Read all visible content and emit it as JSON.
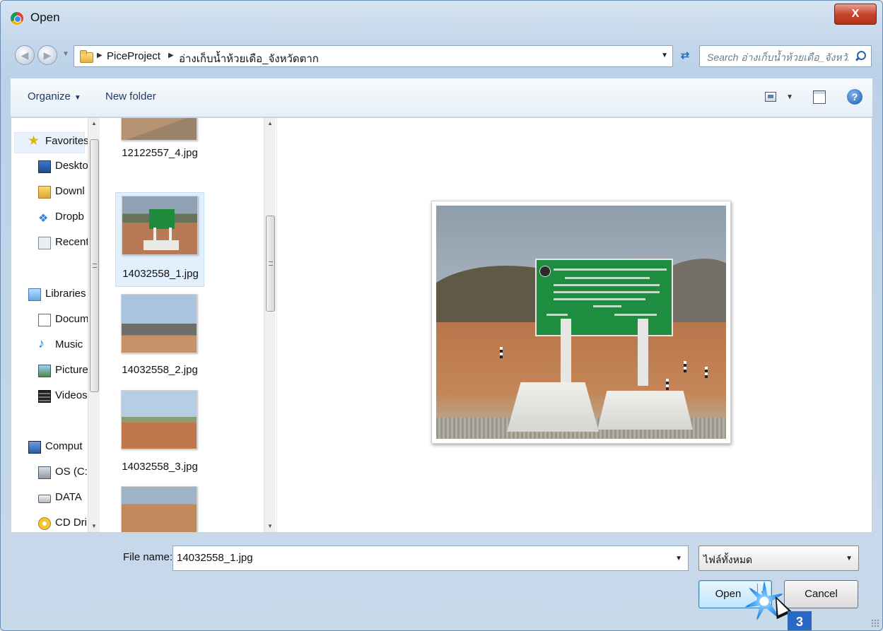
{
  "window": {
    "title": "Open",
    "close_label": "X"
  },
  "address": {
    "crumbs": [
      "PiceProject",
      "อ่างเก็บน้ำห้วยเดือ_จังหวัดตาก"
    ],
    "search_placeholder": "Search อ่างเก็บน้ำห้วยเดือ_จังหวั..."
  },
  "toolbar": {
    "organize_label": "Organize",
    "new_folder_label": "New folder",
    "help_label": "?"
  },
  "nav": {
    "items": [
      {
        "label": "Favorites",
        "icon": "star-icon"
      },
      {
        "label": "Deskto",
        "icon": "desktop-icon"
      },
      {
        "label": "Downl",
        "icon": "downloads-icon"
      },
      {
        "label": "Dropb",
        "icon": "dropbox-icon"
      },
      {
        "label": "Recent",
        "icon": "recent-places-icon"
      },
      {
        "label": "Libraries",
        "icon": "libraries-icon"
      },
      {
        "label": "Docum",
        "icon": "documents-icon"
      },
      {
        "label": "Music",
        "icon": "music-icon"
      },
      {
        "label": "Picture",
        "icon": "pictures-icon"
      },
      {
        "label": "Videos",
        "icon": "videos-icon"
      },
      {
        "label": "Comput",
        "icon": "computer-icon"
      },
      {
        "label": "OS (C:)",
        "icon": "drive-c-icon"
      },
      {
        "label": "DATA",
        "icon": "drive-data-icon"
      },
      {
        "label": "CD Dri",
        "icon": "cd-drive-icon"
      }
    ]
  },
  "files": {
    "items": [
      {
        "label": "12122557_4.jpg",
        "selected": false
      },
      {
        "label": "14032558_1.jpg",
        "selected": true
      },
      {
        "label": "14032558_2.jpg",
        "selected": false
      },
      {
        "label": "14032558_3.jpg",
        "selected": false
      },
      {
        "label": "",
        "selected": false
      }
    ]
  },
  "footer": {
    "filename_label": "File name:",
    "filename_value": "14032558_1.jpg",
    "filter_value": "ไฟล์ทั้งหมด",
    "open_label": "Open",
    "cancel_label": "Cancel",
    "step_number": "3"
  },
  "colors": {
    "accent": "#2968c4",
    "close_button": "#c8452c",
    "selection": "#e2effc"
  }
}
